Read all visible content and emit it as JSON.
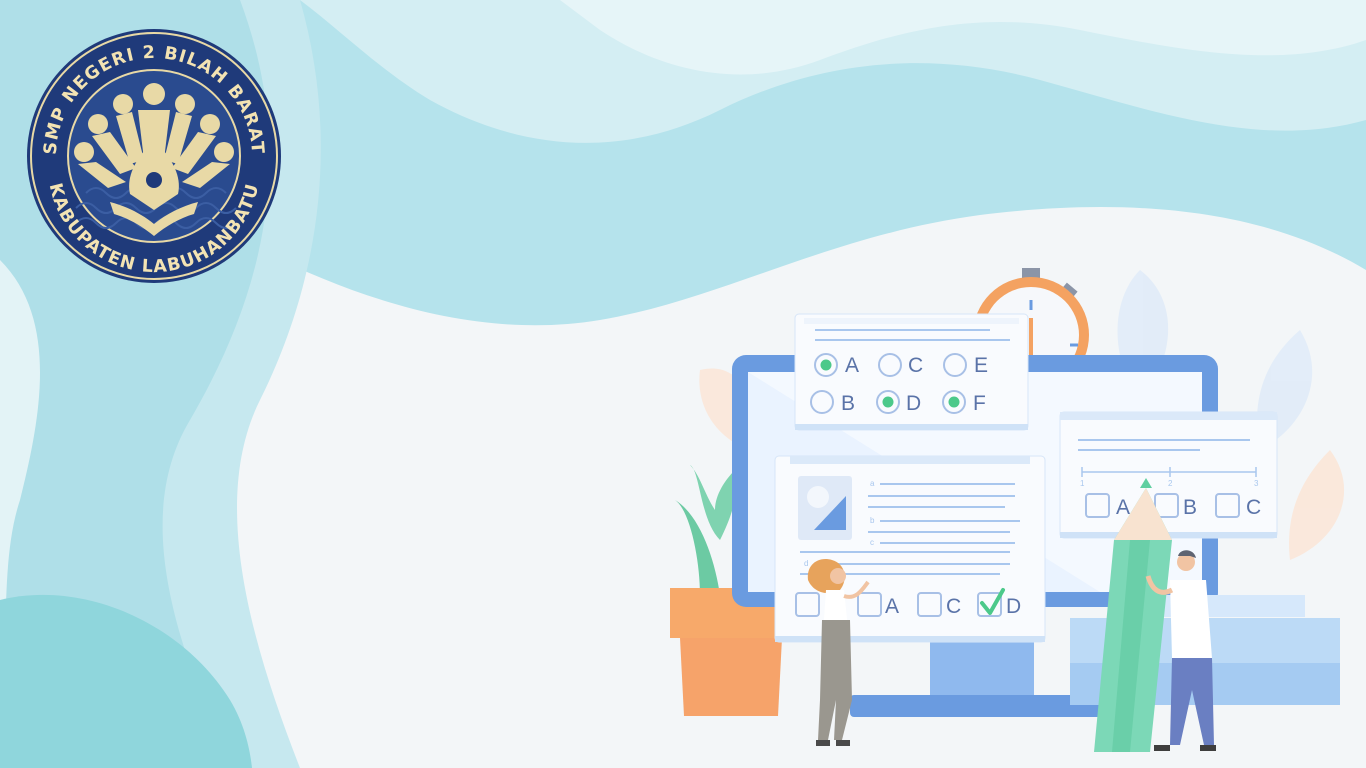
{
  "school_seal": {
    "top_text": "SMP NEGERI  2  BILAH BARAT",
    "bottom_text": "KABUPATEN LABUHANBATU",
    "colors": {
      "ring": "#1f3a7a",
      "emblem": "#e8d9a6"
    }
  },
  "quiz_card_top": {
    "options": [
      {
        "letter": "A",
        "selected": true
      },
      {
        "letter": "C",
        "selected": false
      },
      {
        "letter": "E",
        "selected": false
      },
      {
        "letter": "B",
        "selected": false
      },
      {
        "letter": "D",
        "selected": true
      },
      {
        "letter": "F",
        "selected": true
      }
    ]
  },
  "quiz_card_main": {
    "row_letters": [
      "a",
      "b",
      "c",
      "d"
    ],
    "checkbox_options": [
      {
        "letter": "A",
        "checked": false
      },
      {
        "letter": "C",
        "checked": false
      },
      {
        "letter": "D",
        "checked": true
      }
    ]
  },
  "quiz_card_right": {
    "scale_numbers": [
      "1",
      "2",
      "3"
    ],
    "checkbox_options": [
      {
        "letter": "A",
        "checked": false
      },
      {
        "letter": "B",
        "checked": false
      },
      {
        "letter": "C",
        "checked": false
      }
    ]
  },
  "colors": {
    "wave_light": "#cdeaf1",
    "wave_mid": "#b3e3ec",
    "wave_teal": "#8fd6dc",
    "monitor_blue": "#6a9be0",
    "accent_green": "#5fcfa0",
    "timer_orange": "#f4a261"
  }
}
